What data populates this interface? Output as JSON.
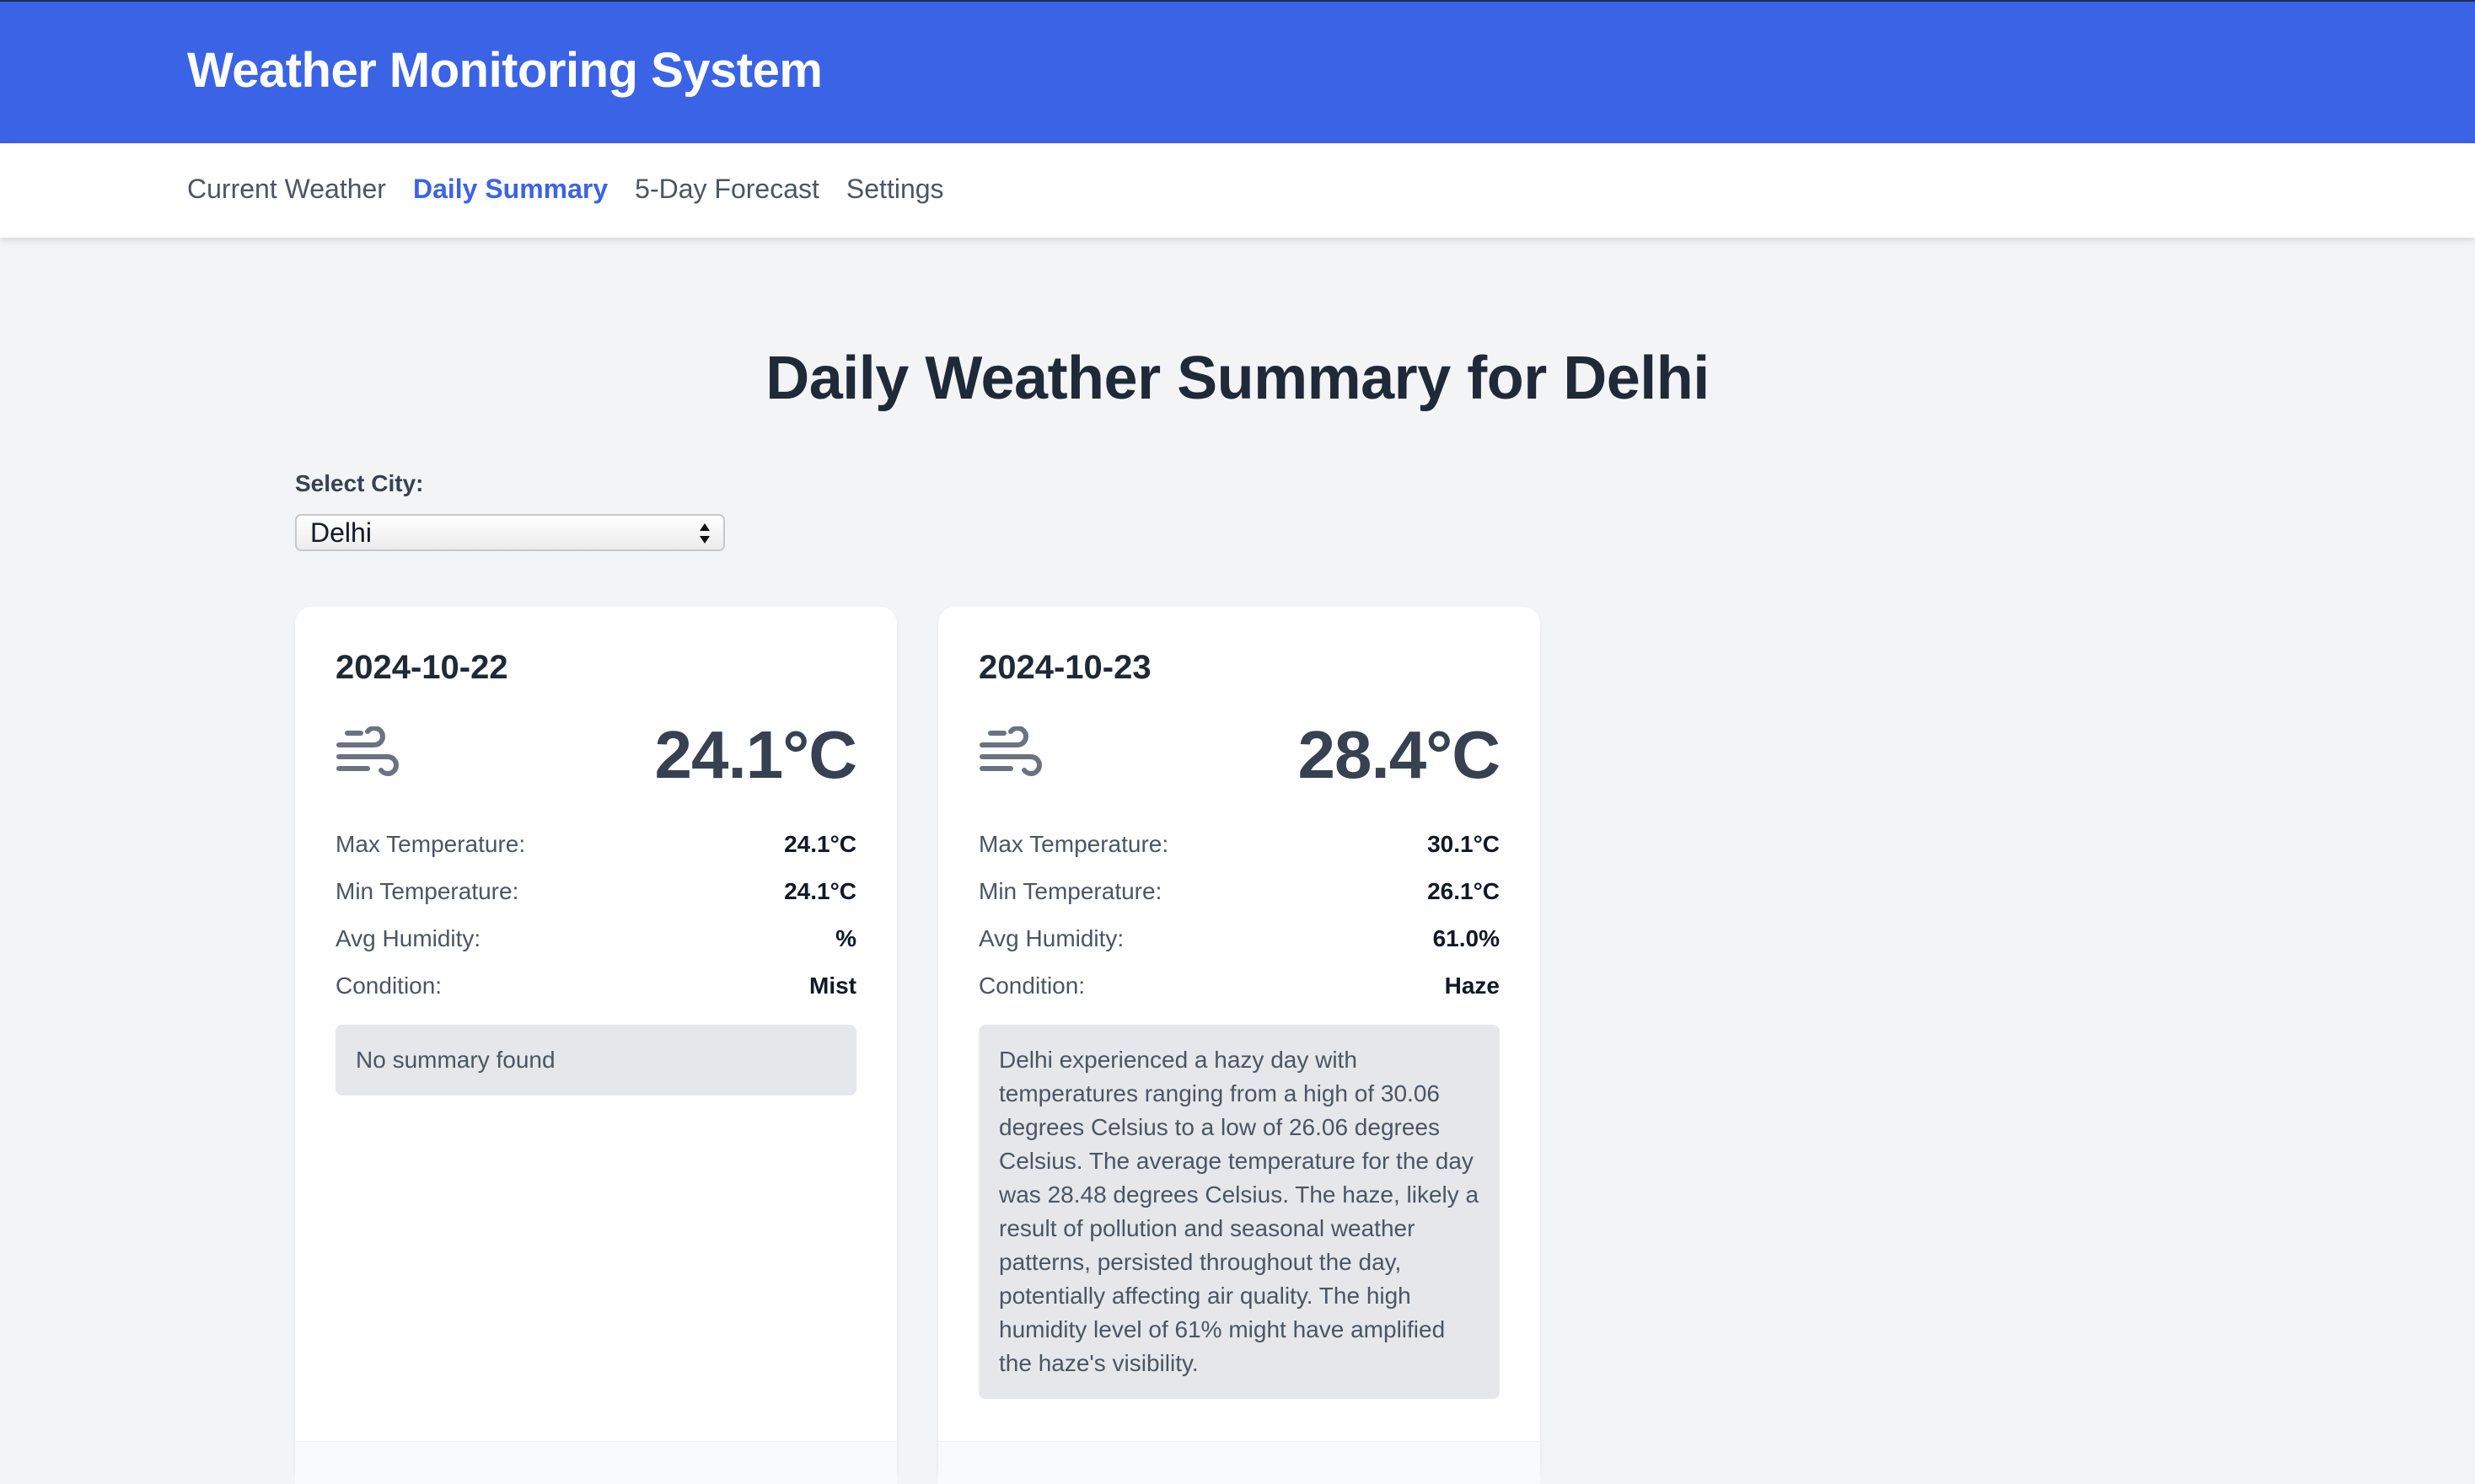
{
  "header": {
    "title": "Weather Monitoring System"
  },
  "nav": {
    "items": [
      {
        "label": "Current Weather",
        "active": false
      },
      {
        "label": "Daily Summary",
        "active": true
      },
      {
        "label": "5-Day Forecast",
        "active": false
      },
      {
        "label": "Settings",
        "active": false
      }
    ]
  },
  "page": {
    "title": "Daily Weather Summary for Delhi",
    "city_label": "Select City:",
    "city_selected": "Delhi"
  },
  "cards": [
    {
      "date": "2024-10-22",
      "icon": "wind-icon",
      "temperature": "24.1°C",
      "stats": [
        {
          "label": "Max Temperature:",
          "value": "24.1°C"
        },
        {
          "label": "Min Temperature:",
          "value": "24.1°C"
        },
        {
          "label": "Avg Humidity:",
          "value": "%"
        },
        {
          "label": "Condition:",
          "value": "Mist"
        }
      ],
      "summary": "No summary found"
    },
    {
      "date": "2024-10-23",
      "icon": "wind-icon",
      "temperature": "28.4°C",
      "stats": [
        {
          "label": "Max Temperature:",
          "value": "30.1°C"
        },
        {
          "label": "Min Temperature:",
          "value": "26.1°C"
        },
        {
          "label": "Avg Humidity:",
          "value": "61.0%"
        },
        {
          "label": "Condition:",
          "value": "Haze"
        }
      ],
      "summary": "Delhi experienced a hazy day with temperatures ranging from a high of 30.06 degrees Celsius to a low of 26.06 degrees Celsius. The average temperature for the day was 28.48 degrees Celsius. The haze, likely a result of pollution and seasonal weather patterns, persisted throughout the day, potentially affecting air quality. The high humidity level of 61% might have amplified the haze's visibility."
    }
  ],
  "colors": {
    "header_bg": "#3b63e6",
    "nav_active": "#3b63e6",
    "page_bg": "#f3f4f6",
    "summary_bg": "#e5e7eb"
  }
}
